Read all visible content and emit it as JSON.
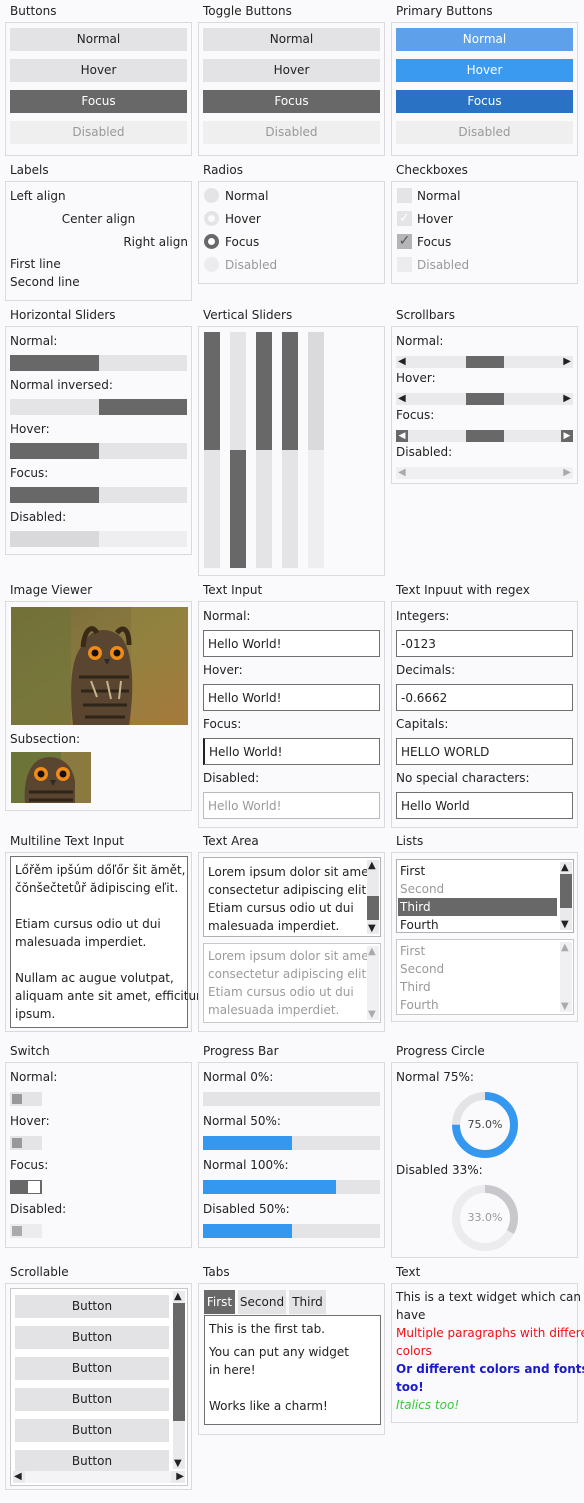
{
  "buttons": {
    "title": "Buttons",
    "normal": "Normal",
    "hover": "Hover",
    "focus": "Focus",
    "disabled": "Disabled"
  },
  "toggle_buttons": {
    "title": "Toggle Buttons",
    "normal": "Normal",
    "hover": "Hover",
    "focus": "Focus",
    "disabled": "Disabled"
  },
  "primary_buttons": {
    "title": "Primary Buttons",
    "normal": "Normal",
    "hover": "Hover",
    "focus": "Focus",
    "disabled": "Disabled"
  },
  "labels": {
    "title": "Labels",
    "left": "Left align",
    "center": "Center align",
    "right": "Right align",
    "first": "First line",
    "second": "Second line"
  },
  "radios": {
    "title": "Radios",
    "normal": "Normal",
    "hover": "Hover",
    "focus": "Focus",
    "disabled": "Disabled"
  },
  "checkboxes": {
    "title": "Checkboxes",
    "normal": "Normal",
    "hover": "Hover",
    "focus": "Focus",
    "disabled": "Disabled"
  },
  "hsliders": {
    "title": "Horizontal Sliders",
    "normal": "Normal:",
    "inversed": "Normal inversed:",
    "hover": "Hover:",
    "focus": "Focus:",
    "disabled": "Disabled:",
    "value": 0.5
  },
  "vsliders": {
    "title": "Vertical Sliders",
    "values": [
      0.5,
      0.5,
      0.5,
      0.5,
      0.5
    ]
  },
  "scrollbars": {
    "title": "Scrollbars",
    "normal": "Normal:",
    "hover": "Hover:",
    "focus": "Focus:",
    "disabled": "Disabled:"
  },
  "image_viewer": {
    "title": "Image Viewer",
    "subsection": "Subsection:"
  },
  "text_input": {
    "title": "Text Input",
    "normal_label": "Normal:",
    "normal_value": "Hello World!",
    "hover_label": "Hover:",
    "hover_value": "Hello World!",
    "focus_label": "Focus:",
    "focus_value": "Hello World!",
    "disabled_label": "Disabled:",
    "disabled_value": "Hello World!"
  },
  "regex_input": {
    "title": "Text Inpuut with regex",
    "int_label": "Integers:",
    "int_value": "-0123",
    "dec_label": "Decimals:",
    "dec_value": "-0.6662",
    "cap_label": "Capitals:",
    "cap_value": "HELLO WORLD",
    "nospec_label": "No special characters:",
    "nospec_value": "Hello World"
  },
  "multiline": {
    "title": "Multiline Text Input",
    "lines": [
      "Lőřěm ipšúm dőľőr šit ămět,",
      "čŏnšečtetůř ădipiscing eľit.",
      "",
      "Etiam cursus odio ut dui",
      "malesuada imperdiet.",
      "",
      "Nullam ac augue volutpat,",
      "aliquam ante sit amet, efficitur",
      "ipsum."
    ]
  },
  "textarea": {
    "title": "Text Area",
    "lines": [
      "Lorem ipsum dolor sit amet,",
      "consectetur adipiscing elit.",
      "Etiam cursus odio ut dui",
      "malesuada imperdiet."
    ]
  },
  "lists": {
    "title": "Lists",
    "items": [
      "First",
      "Second",
      "Third",
      "Fourth"
    ],
    "selected": "Third"
  },
  "switch": {
    "title": "Switch",
    "normal": "Normal:",
    "hover": "Hover:",
    "focus": "Focus:",
    "disabled": "Disabled:"
  },
  "progress_bar": {
    "title": "Progress Bar",
    "p0": "Normal 0%:",
    "p50": "Normal 50%:",
    "p100": "Normal 100%:",
    "pdis": "Disabled 50%:",
    "values": [
      0,
      0.5,
      0.75,
      0.5
    ]
  },
  "progress_circle": {
    "title": "Progress Circle",
    "normal_label": "Normal 75%:",
    "normal_value": "75.0%",
    "disabled_label": "Disabled 33%:",
    "disabled_value": "33.0%",
    "normal_fraction": 0.75,
    "disabled_fraction": 0.33
  },
  "scrollable": {
    "title": "Scrollable",
    "button": "Button"
  },
  "tabs": {
    "title": "Tabs",
    "first": "First",
    "second": "Second",
    "third": "Third",
    "line1": "This is the first tab.",
    "line2": "You can put any widget",
    "line3": "in here!",
    "line4": "Works like a charm!"
  },
  "text": {
    "title": "Text",
    "l1": "This is a text widget which can",
    "l2": "have",
    "l3": "Multiple paragraphs with different",
    "l4": "colors",
    "l5": "Or different colors and fonts",
    "l6": "too!",
    "l7": "Italics too!"
  },
  "colors": {
    "accent": "#3498f0",
    "focus_gray": "#686868",
    "red": "#ee1111",
    "blue": "#1a1ad0",
    "green": "#33cc33"
  }
}
